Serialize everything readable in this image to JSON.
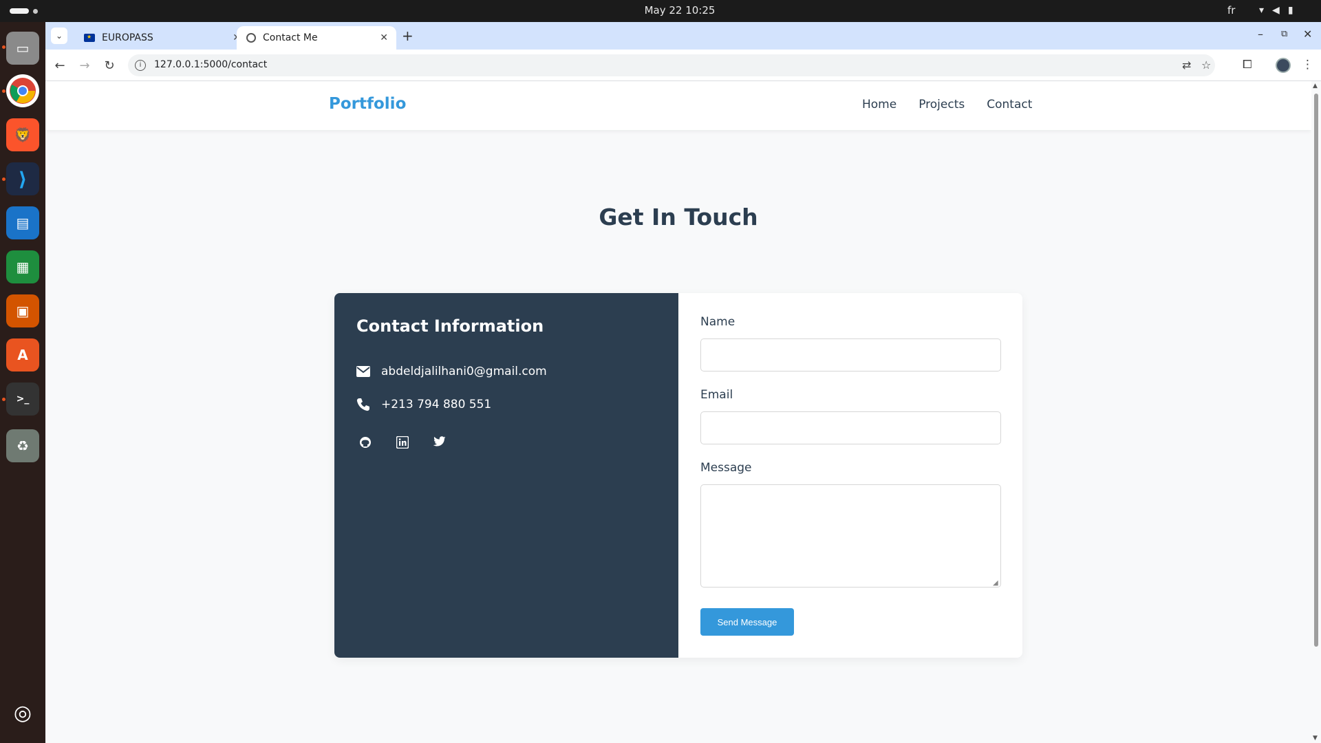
{
  "system": {
    "clock": "May 22  10:25",
    "language": "fr"
  },
  "browser": {
    "tabs": [
      {
        "title": "EUROPASS",
        "active": false
      },
      {
        "title": "Contact Me",
        "active": true
      }
    ],
    "url": "127.0.0.1:5000/contact"
  },
  "site": {
    "logo": "Portfolio",
    "nav": [
      "Home",
      "Projects",
      "Contact"
    ],
    "page_title": "Get In Touch",
    "contact_info": {
      "title": "Contact Information",
      "email": "abdeldjalilhani0@gmail.com",
      "phone": "+213 794 880 551",
      "socials": [
        "github-icon",
        "linkedin-icon",
        "twitter-icon"
      ]
    },
    "form": {
      "name_label": "Name",
      "name_value": "",
      "email_label": "Email",
      "email_value": "",
      "message_label": "Message",
      "message_value": "",
      "submit_label": "Send Message"
    }
  },
  "colors": {
    "accent": "#3498db",
    "panel": "#2c3e50",
    "page_bg": "#f8f9fa"
  }
}
